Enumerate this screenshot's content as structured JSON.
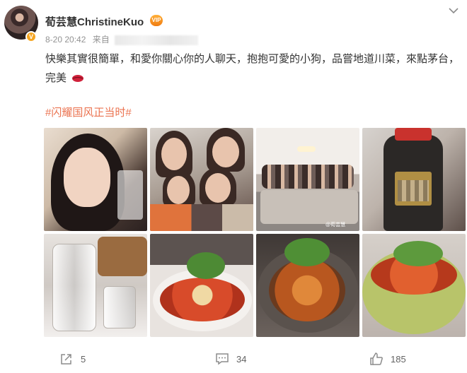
{
  "post": {
    "username": "荀芸慧ChristineKuo",
    "date": "8-20 20:42",
    "source_prefix": "来自",
    "content": "快樂其實很簡單，和愛你關心你的人聊天，抱抱可愛的小狗，品嘗地道川菜，來點茅台，完美",
    "hashtag": "#闪耀国风正当时#",
    "photo_watermark": "@荀芸慧",
    "actions": {
      "share_count": "5",
      "comment_count": "34",
      "like_count": "185"
    }
  },
  "colors": {
    "hashtag": "#eb7350",
    "meta_text": "#939393",
    "verified_badge": "#f5a623",
    "action_text": "#636363"
  },
  "icons": [
    "verified-badge-icon",
    "vip-badge-icon",
    "more-chevron-icon",
    "lips-emoji-icon",
    "share-icon",
    "comment-icon",
    "like-icon"
  ]
}
